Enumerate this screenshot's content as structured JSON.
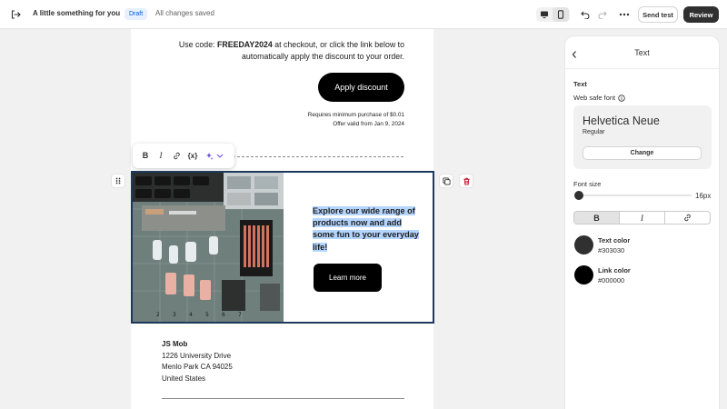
{
  "header": {
    "title": "A little something for you",
    "status_badge": "Draft",
    "save_status": "All changes saved",
    "send_test_label": "Send test",
    "review_label": "Review"
  },
  "email": {
    "promo_prefix": "Use code: ",
    "promo_code": "FREEDAY2024",
    "promo_suffix": " at checkout, or click the link below to automatically apply the discount to your order.",
    "apply_button": "Apply discount",
    "requirement": "Requires minimum purchase of $0.01",
    "offer_valid": "Offer valid from Jan 9, 2024",
    "block_text": "Explore our wide range of products now and add some fun to your everyday life!",
    "learn_more": "Learn more",
    "address": {
      "name": "JS Mob",
      "street": "1226 University Drive",
      "city": "Menlo Park CA 94025",
      "country": "United States"
    }
  },
  "toolbar": {
    "bold": "B",
    "italic": "I",
    "variable": "{x}"
  },
  "panel": {
    "title": "Text",
    "section": "Text",
    "web_safe_font_label": "Web safe font",
    "font_name": "Helvetica Neue",
    "font_style": "Regular",
    "change_label": "Change",
    "font_size_label": "Font size",
    "font_size_value": "16px",
    "font_size": 16,
    "format": {
      "bold": "B",
      "italic": "I"
    },
    "text_color_label": "Text color",
    "text_color": "#303030",
    "link_color_label": "Link color",
    "link_color": "#000000"
  },
  "colors": {
    "accent_selection": "#b4d5fe",
    "badge_text": "#005bd3",
    "primary_dark": "#303030"
  }
}
